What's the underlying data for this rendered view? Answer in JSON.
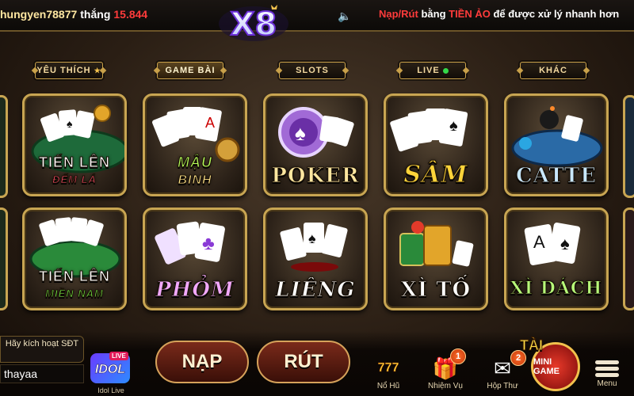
{
  "top_bar": {
    "winner_username": "hungyen78877",
    "winner_verb": "thắng",
    "winner_amount": "15.844",
    "logo_text": "X8",
    "notice_parts": [
      "Nạp/Rút",
      " bằng ",
      "TIỀN ẢO",
      " để được xử lý nhanh hơn"
    ]
  },
  "tabs": [
    {
      "label": "YÊU THÍCH",
      "badge": "★"
    },
    {
      "label": "GAME BÀI"
    },
    {
      "label": "SLOTS"
    },
    {
      "label": "LIVE"
    },
    {
      "label": "KHÁC"
    }
  ],
  "active_tab": "GAME BÀI",
  "games": [
    {
      "title": "TIẾN LÊN",
      "subtitle": "ĐẾM LÁ"
    },
    {
      "title": "MẬU",
      "subtitle": "BINH"
    },
    {
      "title": "POKER"
    },
    {
      "title": "SÂM"
    },
    {
      "title": "CATTE"
    },
    {
      "title": "TIẾN LÊN",
      "subtitle": "MIỀN NAM"
    },
    {
      "title": "PHỎM"
    },
    {
      "title": "LIÊNG"
    },
    {
      "title": "XÌ TỐ"
    },
    {
      "title": "XÌ DÁCH"
    }
  ],
  "bottom": {
    "activate_sdt_label": "Hãy kích hoạt SĐT",
    "username": "thayaa",
    "idol_live_label": "Idol Live",
    "idol_badge": "IDOL",
    "idol_live_tag": "LIVE",
    "deposit_label": "NẠP",
    "withdraw_label": "RÚT",
    "jackpot_label": "Nổ Hũ",
    "jackpot_icon_text": "777",
    "missions_label": "Nhiệm Vụ",
    "missions_count": "1",
    "inbox_label": "Hộp Thư",
    "inbox_count": "2",
    "tai_label": "TÀI",
    "minigame_label": "MINI GAME",
    "menu_label": "Menu"
  },
  "colors": {
    "gold_border": "#c8a552",
    "ticker_highlight": "#ff3b3b",
    "live_dot": "#34d84a"
  }
}
